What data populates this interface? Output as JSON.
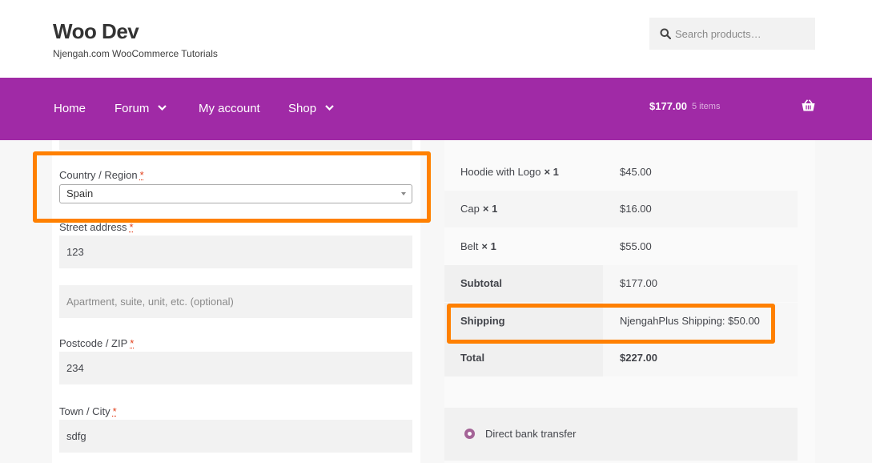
{
  "header": {
    "site_title": "Woo Dev",
    "tagline": "Njengah.com WooCommerce Tutorials",
    "search_placeholder": "Search products…"
  },
  "nav": {
    "items": [
      {
        "label": "Home",
        "has_dropdown": false
      },
      {
        "label": "Forum",
        "has_dropdown": true
      },
      {
        "label": "My account",
        "has_dropdown": false
      },
      {
        "label": "Shop",
        "has_dropdown": true
      }
    ],
    "cart_total": "$177.00",
    "cart_count": "5 items"
  },
  "billing": {
    "country_label": "Country / Region",
    "country_value": "Spain",
    "required_mark": "*",
    "street_label": "Street address",
    "street_value": "123",
    "apartment_placeholder": "Apartment, suite, unit, etc. (optional)",
    "postcode_label": "Postcode / ZIP",
    "postcode_value": "234",
    "town_label": "Town / City",
    "town_value": "sdfg"
  },
  "order": {
    "items": [
      {
        "name": "Hoodie with Logo",
        "qty": "× 1",
        "price": "$45.00"
      },
      {
        "name": "Cap",
        "qty": "× 1",
        "price": "$16.00"
      },
      {
        "name": "Belt",
        "qty": "× 1",
        "price": "$55.00"
      }
    ],
    "subtotal_label": "Subtotal",
    "subtotal_value": "$177.00",
    "shipping_label": "Shipping",
    "shipping_value": "NjengahPlus Shipping: $50.00",
    "total_label": "Total",
    "total_value": "$227.00"
  },
  "payment": {
    "method_label": "Direct bank transfer"
  },
  "colors": {
    "nav_bg": "#a02aa6",
    "highlight": "#ff8000",
    "required": "#e2401c",
    "radio": "#a46497"
  }
}
